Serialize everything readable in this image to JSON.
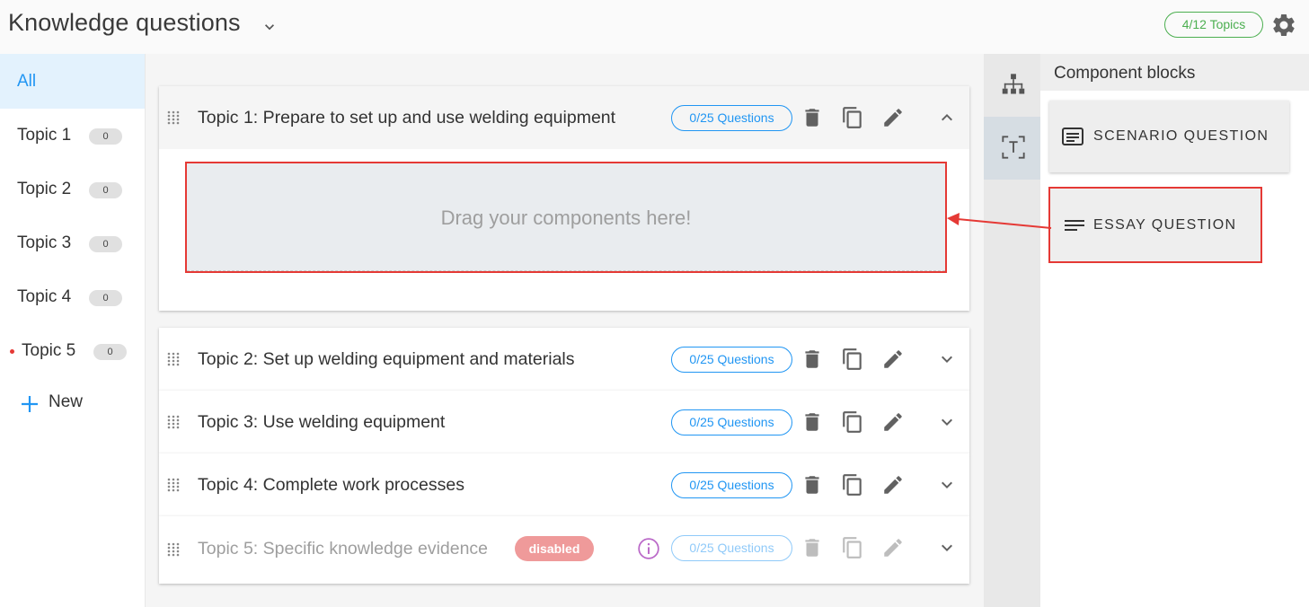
{
  "header": {
    "title": "Knowledge questions",
    "topics_count": "4/12 Topics"
  },
  "sidebar": {
    "all_label": "All",
    "items": [
      {
        "label": "Topic 1",
        "count": "0",
        "flagged": false
      },
      {
        "label": "Topic 2",
        "count": "0",
        "flagged": false
      },
      {
        "label": "Topic 3",
        "count": "0",
        "flagged": false
      },
      {
        "label": "Topic 4",
        "count": "0",
        "flagged": false
      },
      {
        "label": "Topic 5",
        "count": "0",
        "flagged": true
      }
    ],
    "new_label": "New"
  },
  "topics": [
    {
      "title": "Topic 1: Prepare to set up and use welding equipment",
      "questions": "0/25 Questions",
      "expanded": true,
      "disabled": false
    },
    {
      "title": "Topic 2: Set up welding equipment and materials",
      "questions": "0/25 Questions",
      "expanded": false,
      "disabled": false
    },
    {
      "title": "Topic 3: Use welding equipment",
      "questions": "0/25 Questions",
      "expanded": false,
      "disabled": false
    },
    {
      "title": "Topic 4: Complete work processes",
      "questions": "0/25 Questions",
      "expanded": false,
      "disabled": false
    },
    {
      "title": "Topic 5: Specific knowledge evidence",
      "questions": "0/25 Questions",
      "expanded": false,
      "disabled": true,
      "badge": "disabled"
    }
  ],
  "dropzone": {
    "text": "Drag your components here!"
  },
  "component_panel": {
    "title": "Component blocks",
    "blocks": [
      {
        "label": "SCENARIO QUESTION",
        "icon": "subject-box-icon"
      },
      {
        "label": "ESSAY QUESTION",
        "icon": "lines-icon"
      }
    ]
  },
  "colors": {
    "accent": "#2196f3",
    "success": "#4caf50",
    "highlight": "#e53935",
    "disabled_badge": "#ef9a9a"
  }
}
